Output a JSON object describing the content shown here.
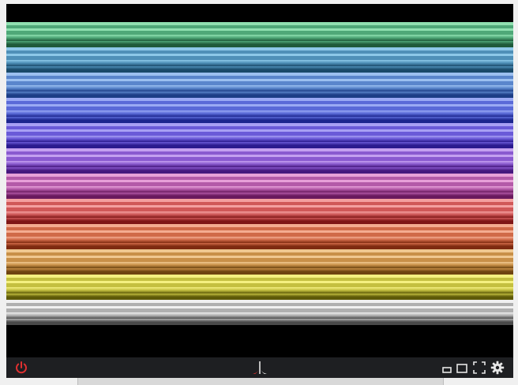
{
  "app": {
    "logo_icon": "atari-fuji-logo",
    "power_icon": "power-icon",
    "small_window_icon": "small-window-icon",
    "window_icon": "window-icon",
    "fullscreen_icon": "fullscreen-icon",
    "settings_icon": "gear-icon",
    "accent_color": "#e03030"
  },
  "screen": {
    "background": "#000000",
    "bars": [
      {
        "name": "green",
        "light": "#8fe0b0",
        "mid": "#4fa878",
        "dark": "#1e5a3a"
      },
      {
        "name": "teal-blue",
        "light": "#8cc8e8",
        "mid": "#4f90b8",
        "dark": "#1a4a6a"
      },
      {
        "name": "sky-blue",
        "light": "#9cc0f0",
        "mid": "#5a86cc",
        "dark": "#1c3e86"
      },
      {
        "name": "blue",
        "light": "#9aaaf4",
        "mid": "#5a6ad8",
        "dark": "#1c268e"
      },
      {
        "name": "indigo",
        "light": "#a8a0f4",
        "mid": "#6a5ad8",
        "dark": "#2a1a8e"
      },
      {
        "name": "violet",
        "light": "#c4a0f0",
        "mid": "#8a5ad0",
        "dark": "#46187e"
      },
      {
        "name": "magenta",
        "light": "#e8a0d8",
        "mid": "#b45aa8",
        "dark": "#6a1a5e"
      },
      {
        "name": "red",
        "light": "#f4a0a0",
        "mid": "#d05858",
        "dark": "#7e1616"
      },
      {
        "name": "orange",
        "light": "#f4ac90",
        "mid": "#d06a48",
        "dark": "#7e2a10"
      },
      {
        "name": "amber",
        "light": "#f0c890",
        "mid": "#c89048",
        "dark": "#6e4410"
      },
      {
        "name": "yellow",
        "light": "#f4f080",
        "mid": "#c4c040",
        "dark": "#5e5a08"
      },
      {
        "name": "grey",
        "light": "#f0f0f0",
        "mid": "#b0b0b0",
        "dark": "#4a4a4a"
      }
    ]
  }
}
